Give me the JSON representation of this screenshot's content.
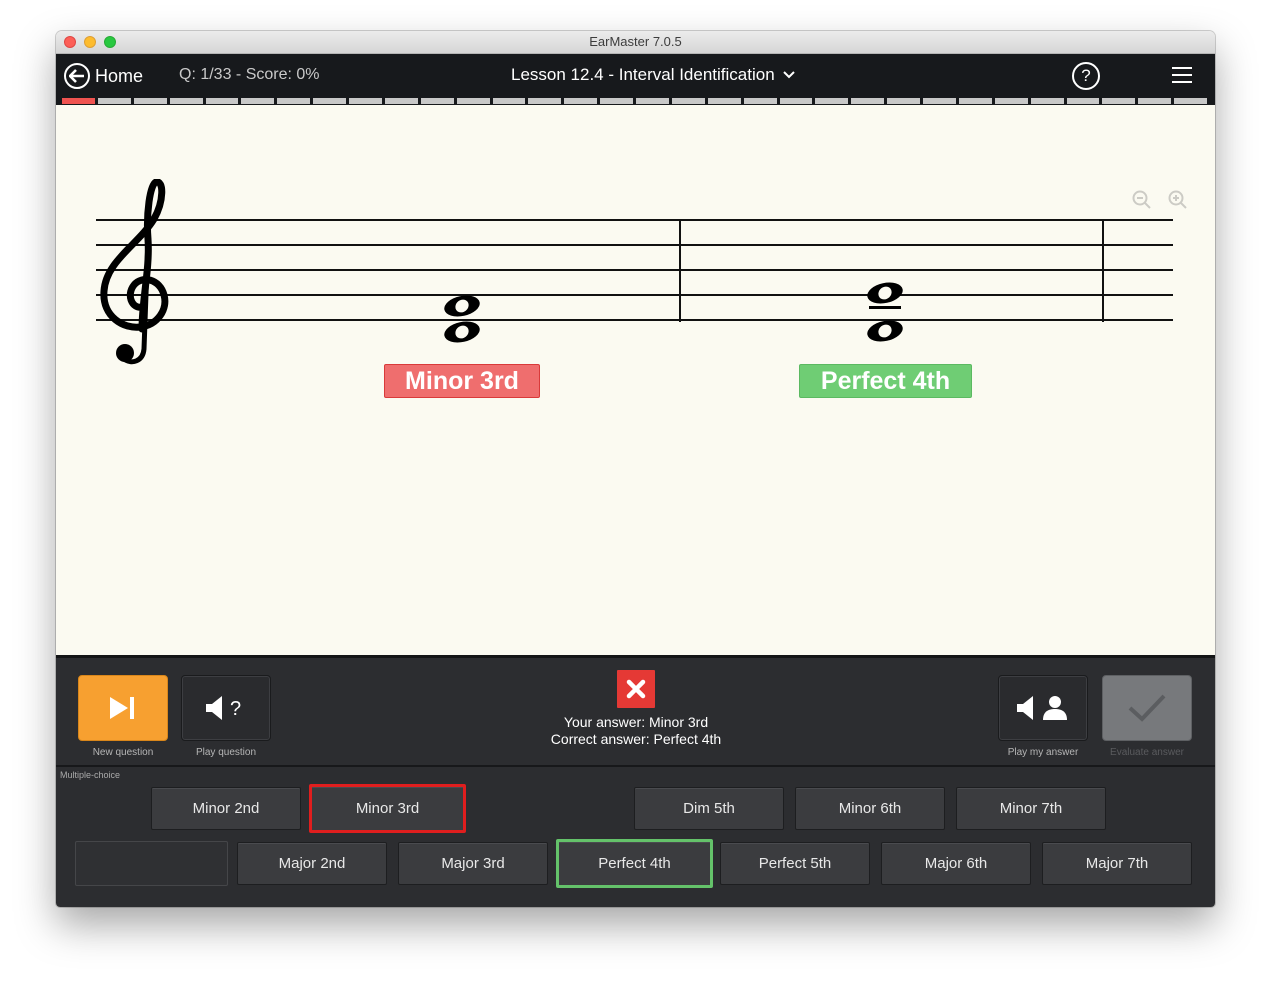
{
  "window": {
    "title": "EarMaster 7.0.5"
  },
  "header": {
    "home_label": "Home",
    "score_text": "Q: 1/33 - Score: 0%",
    "lesson_title": "Lesson 12.4 - Interval Identification",
    "help_symbol": "?"
  },
  "progress": {
    "total": 32,
    "current": 1
  },
  "score": {
    "clef": "treble",
    "measures": [
      {
        "interval_label": "Minor 3rd",
        "label_status": "incorrect",
        "label_color": "#ef6e6e"
      },
      {
        "interval_label": "Perfect 4th",
        "label_status": "correct",
        "label_color": "#6fcd74"
      }
    ]
  },
  "controls": {
    "new_question": "New question",
    "play_question": "Play question",
    "play_my_answer": "Play my answer",
    "evaluate_answer": "Evaluate answer"
  },
  "feedback": {
    "your_answer": "Your answer: Minor 3rd",
    "correct_answer": "Correct answer: Perfect 4th",
    "status": "incorrect",
    "status_color": "#e53935"
  },
  "answers": {
    "section_label": "Multiple-choice",
    "row1": [
      "Minor 2nd",
      "Minor 3rd",
      "Dim 5th",
      "Minor 6th",
      "Minor 7th"
    ],
    "row2": [
      "Major 2nd",
      "Major 3rd",
      "Perfect 4th",
      "Perfect 5th",
      "Major 6th",
      "Major 7th"
    ],
    "selected": "Minor 3rd",
    "correct": "Perfect 4th"
  },
  "colors": {
    "accent_orange": "#f7a030",
    "wrong_red": "#e01e1e",
    "right_green": "#64c26a",
    "appbar": "#17191c"
  }
}
